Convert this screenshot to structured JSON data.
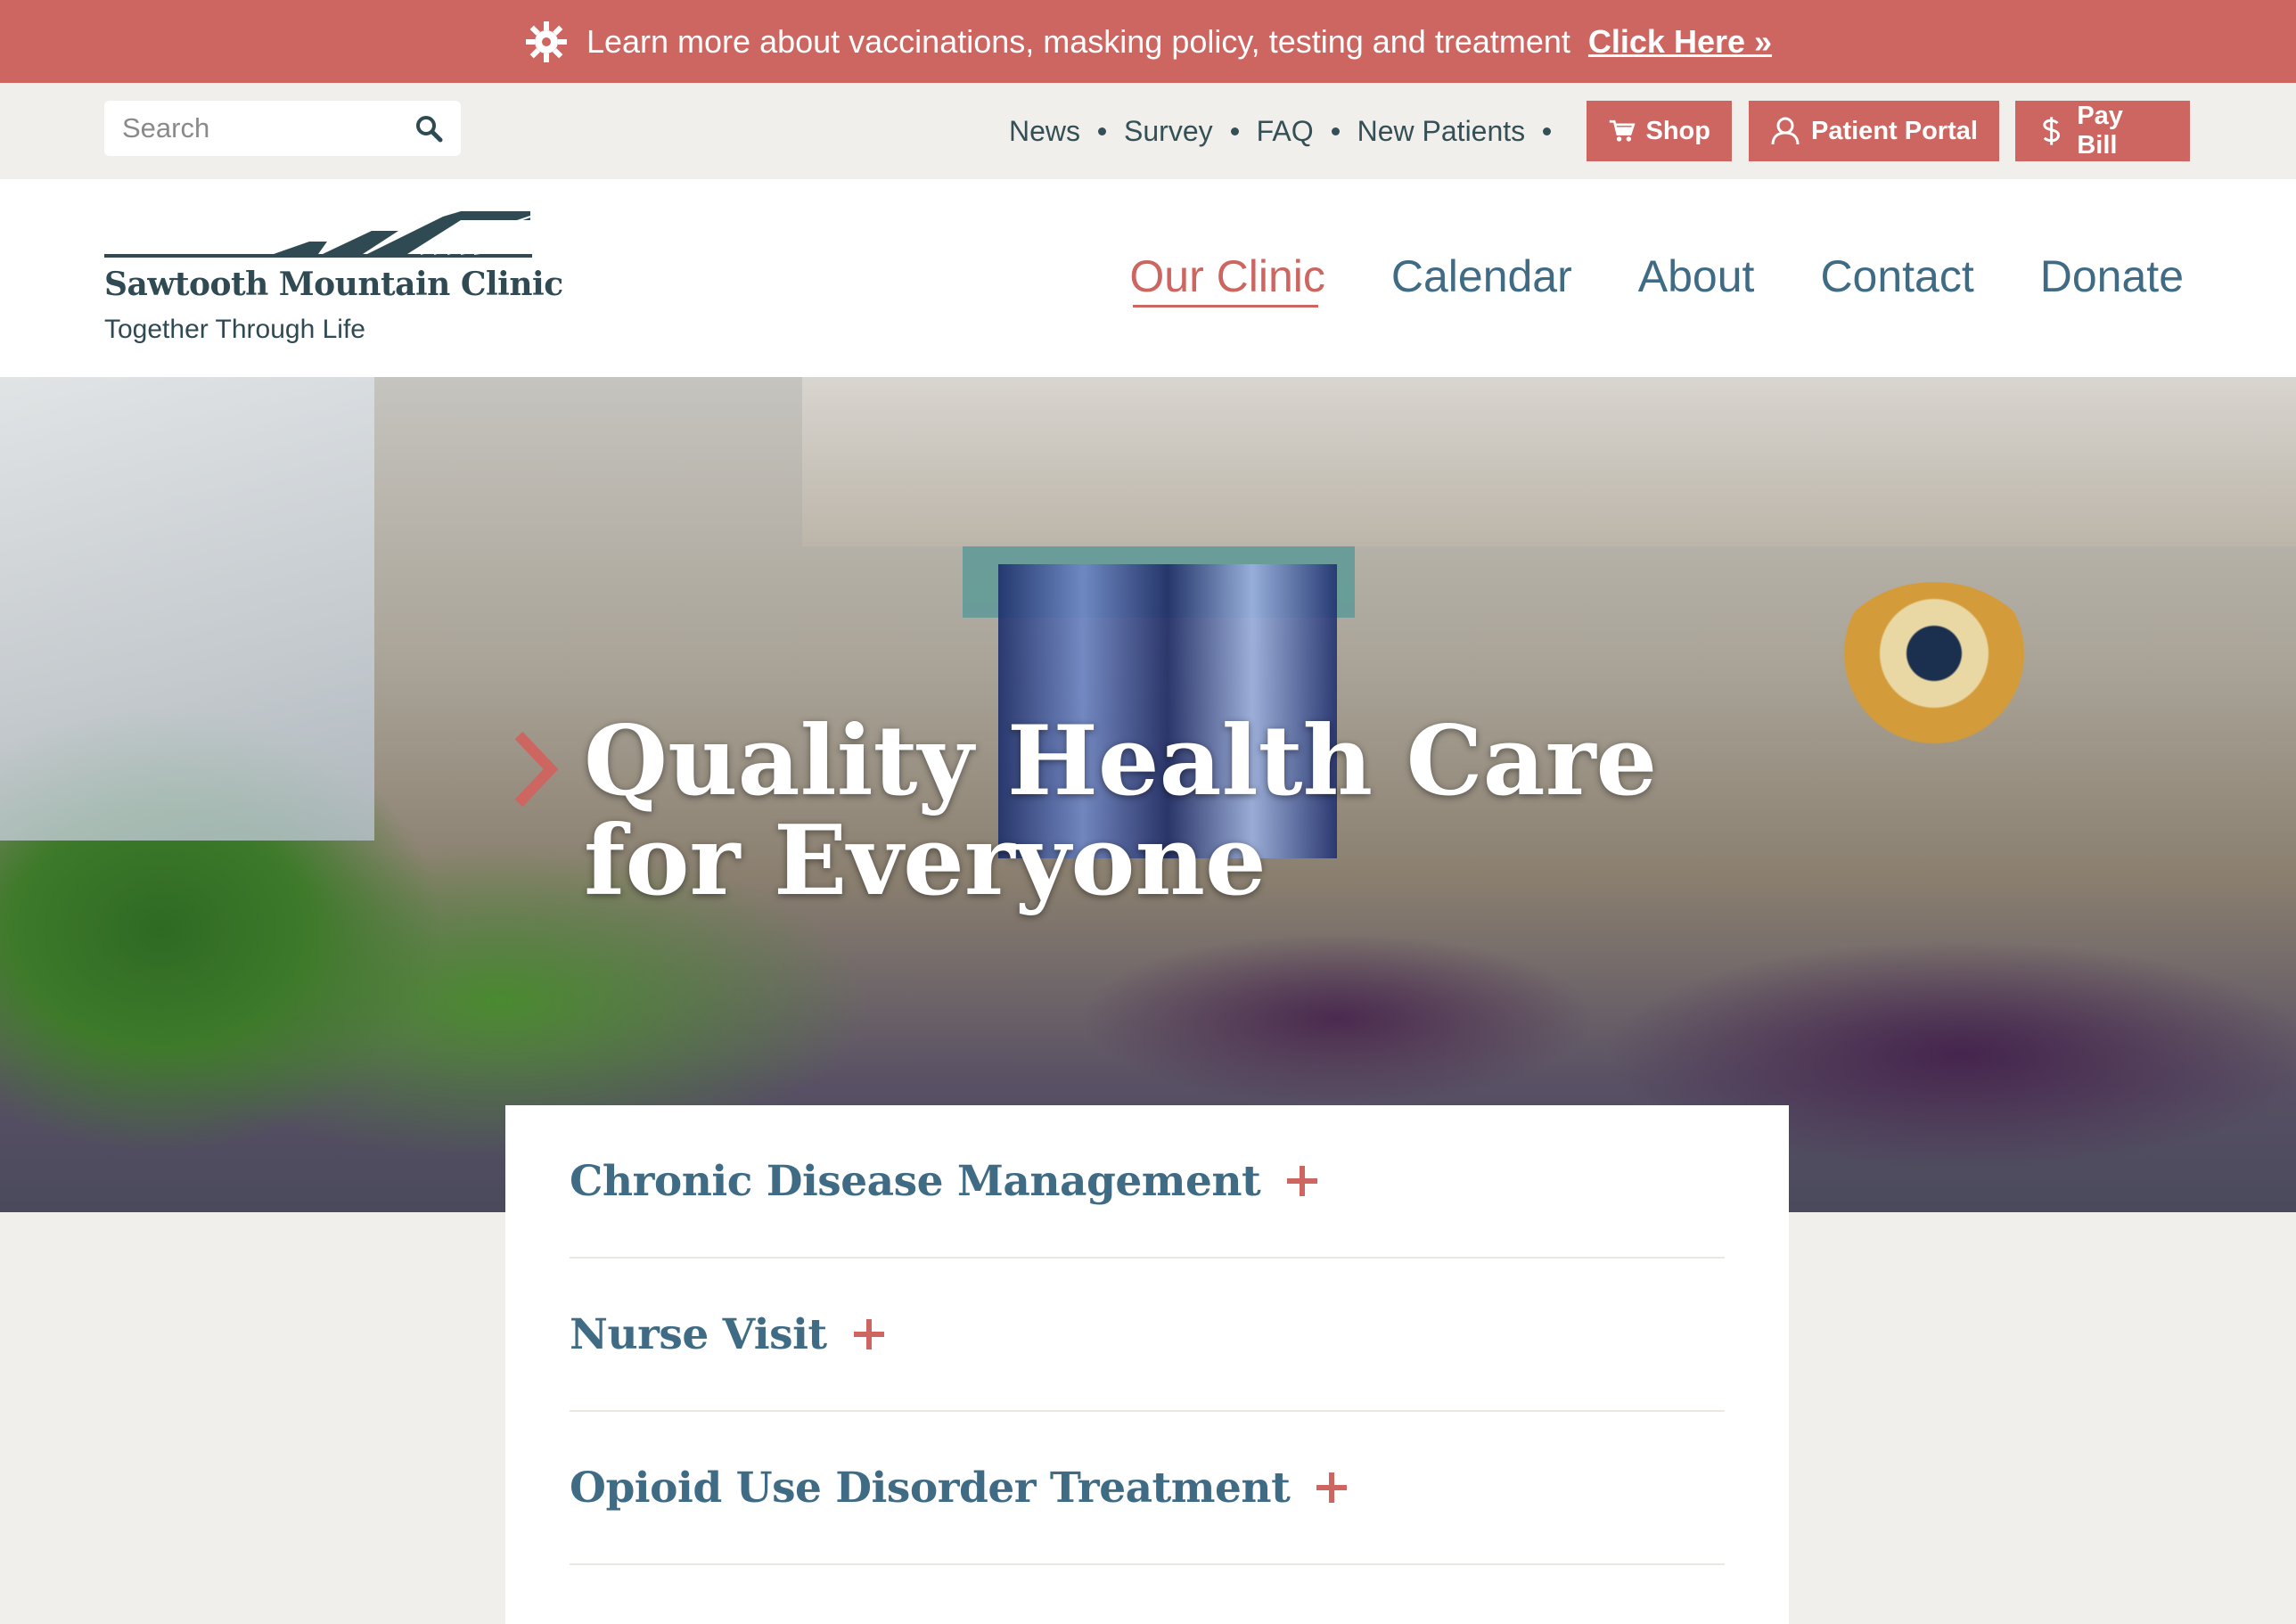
{
  "alert": {
    "text": "Learn more about vaccinations, masking policy, testing and treatment",
    "link_label": "Click Here »"
  },
  "search": {
    "placeholder": "Search"
  },
  "utility_nav": {
    "links": [
      "News",
      "Survey",
      "FAQ",
      "New Patients"
    ]
  },
  "utility_buttons": {
    "shop": "Shop",
    "portal": "Patient Portal",
    "pay": "Pay Bill"
  },
  "brand": {
    "name": "Sawtooth Mountain Clinic",
    "tagline": "Together Through Life"
  },
  "main_nav": {
    "items": [
      "Our Clinic",
      "Calendar",
      "About",
      "Contact",
      "Donate"
    ],
    "active": "Our Clinic"
  },
  "hero": {
    "title": "Quality Health Care for Everyone"
  },
  "services": {
    "items": [
      "Chronic Disease Management",
      "Nurse Visit",
      "Opioid Use Disorder Treatment"
    ]
  },
  "colors": {
    "accent": "#cd6560",
    "nav_blue": "#3f6b85",
    "dark_teal": "#2f4a52",
    "bg": "#f1efeb"
  },
  "icons": {
    "alert": "virus-gear-icon",
    "search": "search-icon",
    "shop": "cart-icon",
    "portal": "user-icon",
    "pay": "dollar-icon"
  }
}
